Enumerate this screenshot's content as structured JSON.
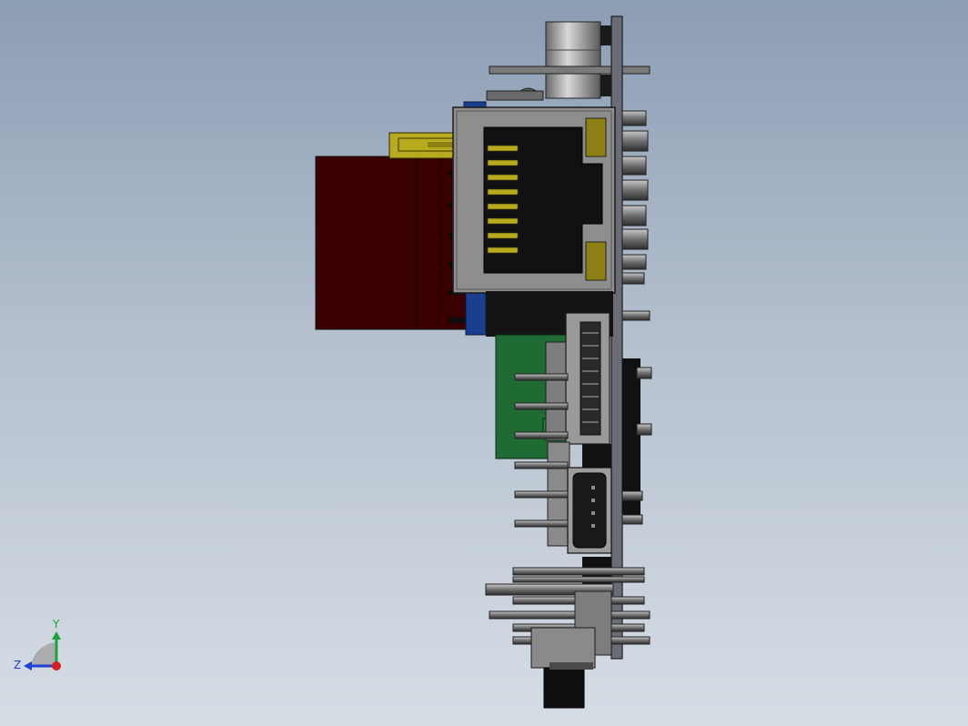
{
  "triad": {
    "y_label": "Y",
    "z_label": "Z",
    "colors": {
      "y": "#1aa33a",
      "z": "#1f3fd6",
      "x": "#d62020"
    }
  },
  "colors": {
    "background_top": "#8c9db4",
    "background_bottom": "#d6dde5",
    "pcb": "#6a6d76",
    "header_red": "#3a0000",
    "connector_yellow": "#b8aa1e",
    "ethernet_gray": "#8e8e8e",
    "green_board": "#1f6b34",
    "blue_part": "#1a3f8e"
  }
}
